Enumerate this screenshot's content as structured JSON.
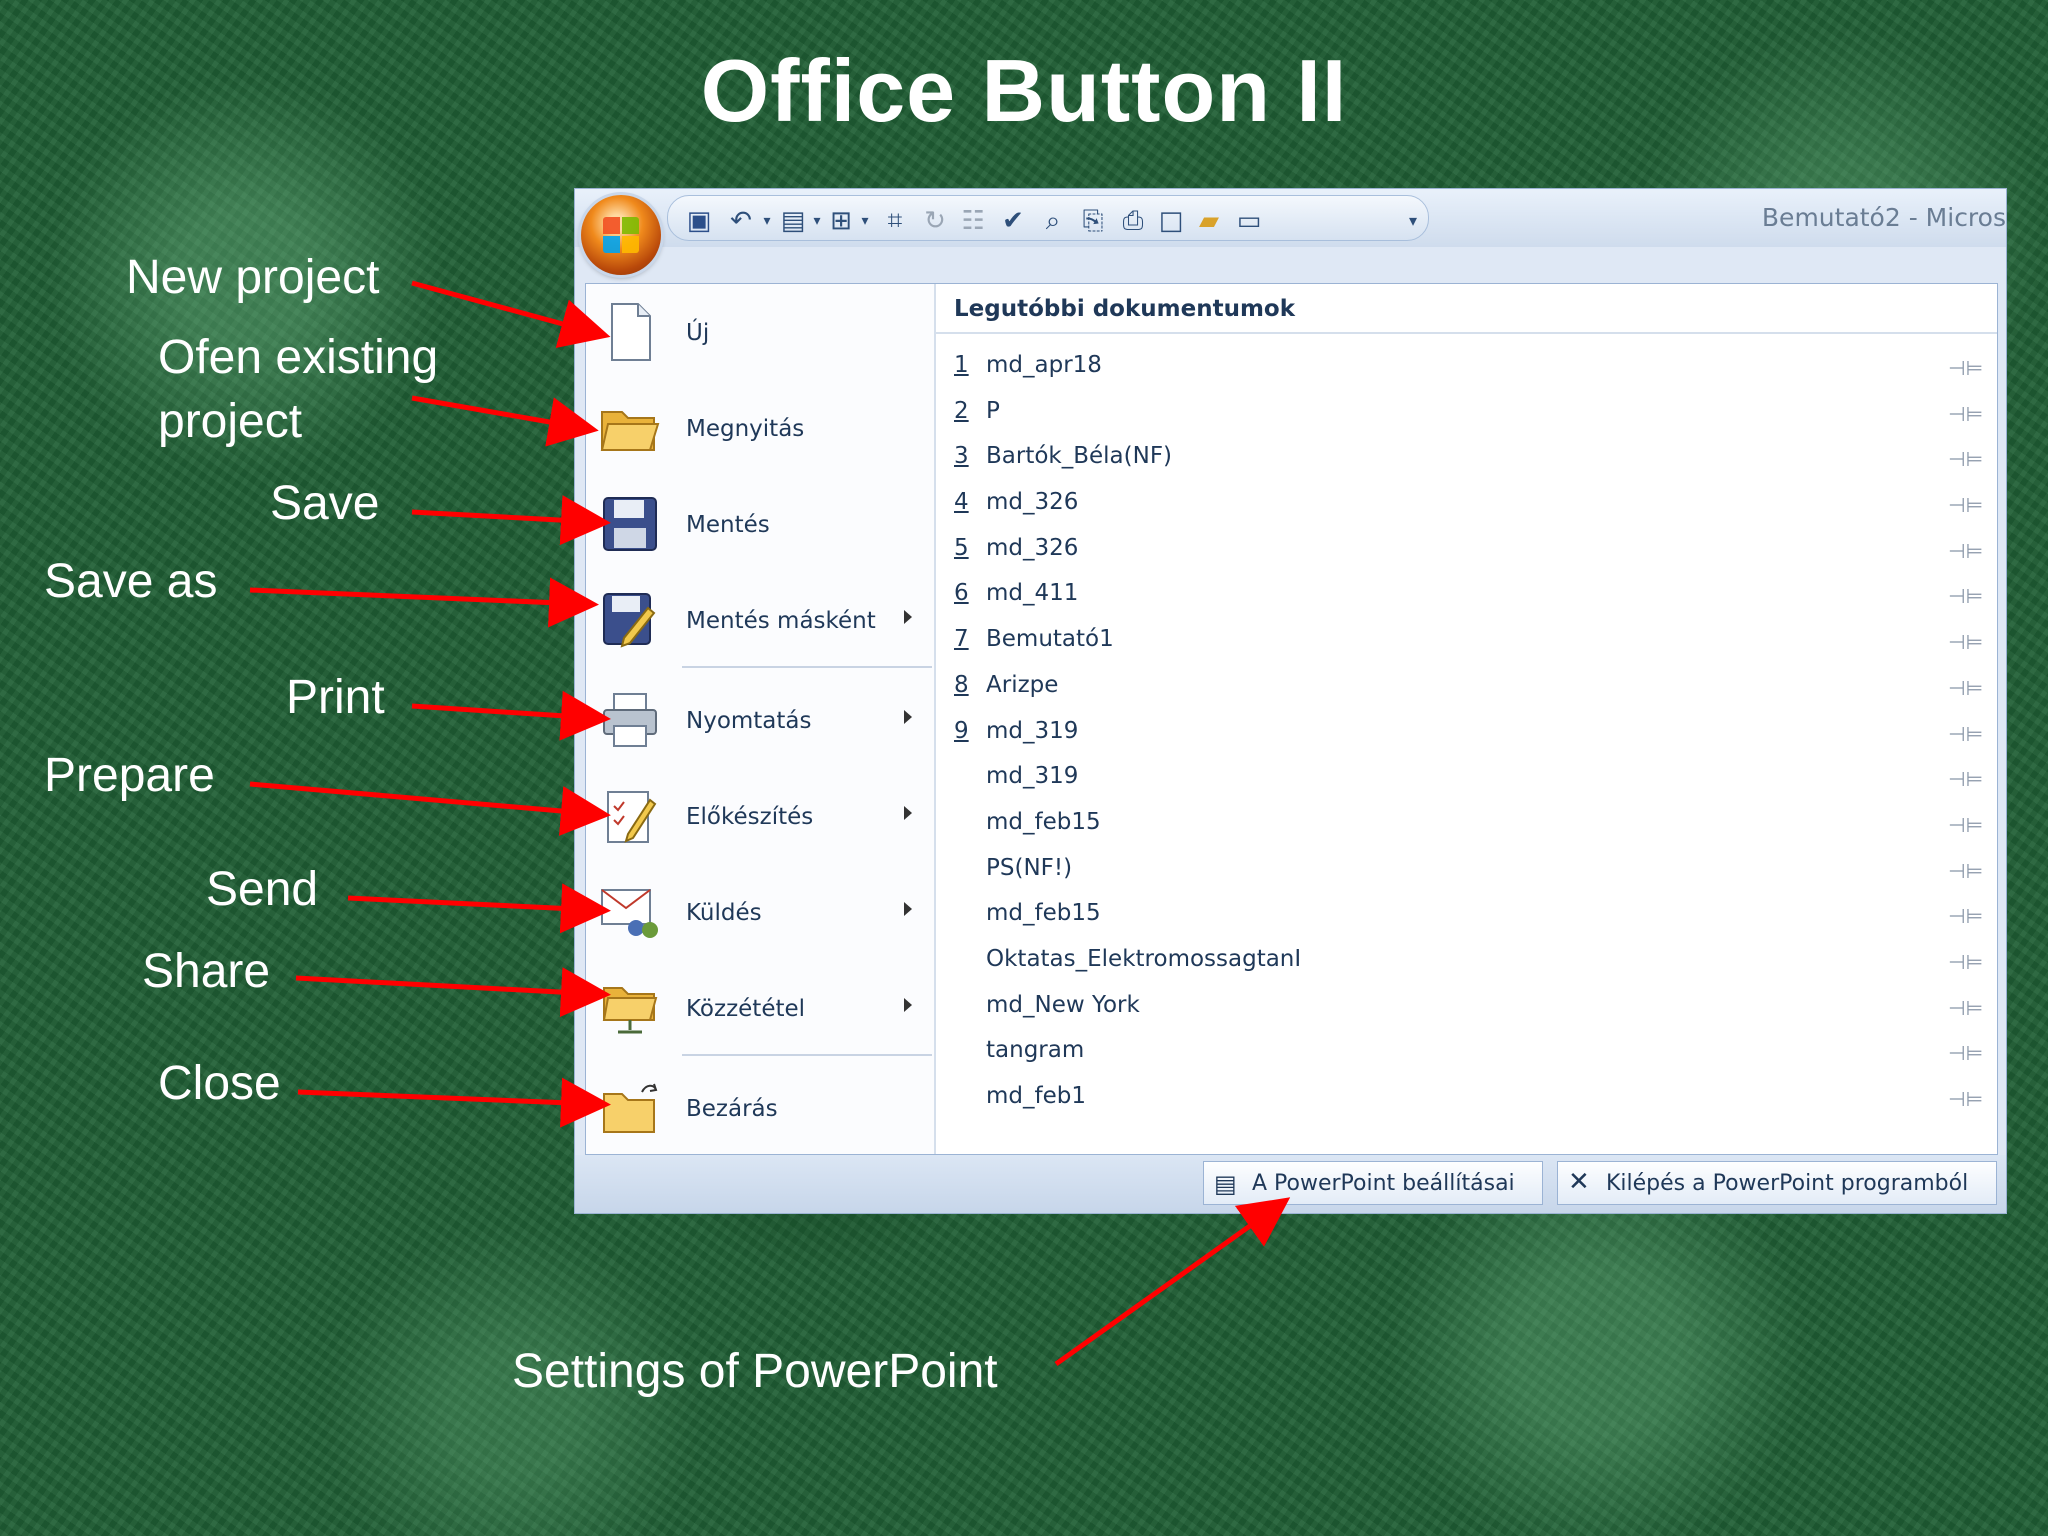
{
  "slide": {
    "title": "Office Button II",
    "labels": {
      "new_project": "New project",
      "open_line1": "Ofen existing",
      "open_line2": "project",
      "save": "Save",
      "save_as": "Save as",
      "print": "Print",
      "prepare": "Prepare",
      "send": "Send",
      "share": "Share",
      "close": "Close",
      "settings": "Settings of PowerPoint"
    },
    "arrow_color": "#ff0000"
  },
  "window": {
    "title": "Bemutató2 - Micros",
    "qat_icons": [
      "save-icon",
      "undo-icon",
      "dropdown-icon",
      "layout-icon",
      "dropdown-icon",
      "new-slide-icon",
      "dropdown-icon",
      "select-icon",
      "redo-icon",
      "paste-icon",
      "spelling-icon",
      "print-preview-icon",
      "attach-icon",
      "print-icon",
      "new-icon",
      "open-icon",
      "slideshow-icon",
      "customize-icon"
    ]
  },
  "menu": {
    "items": [
      {
        "label": "Új",
        "icon": "new-document-icon",
        "submenu": false
      },
      {
        "label": "Megnyitás",
        "icon": "open-folder-icon",
        "submenu": false
      },
      {
        "label": "Mentés",
        "icon": "floppy-disk-icon",
        "submenu": false
      },
      {
        "label": "Mentés másként",
        "icon": "save-as-icon",
        "submenu": true
      },
      {
        "label": "Nyomtatás",
        "icon": "printer-icon",
        "submenu": true
      },
      {
        "label": "Előkészítés",
        "icon": "prepare-icon",
        "submenu": true
      },
      {
        "label": "Küldés",
        "icon": "send-icon",
        "submenu": true
      },
      {
        "label": "Közzététel",
        "icon": "publish-icon",
        "submenu": true
      },
      {
        "label": "Bezárás",
        "icon": "close-folder-icon",
        "submenu": false
      }
    ]
  },
  "recent": {
    "heading": "Legutóbbi dokumentumok",
    "documents": [
      {
        "num": "1",
        "name": "md_apr18"
      },
      {
        "num": "2",
        "name": "P"
      },
      {
        "num": "3",
        "name": "Bartók_Béla(NF)"
      },
      {
        "num": "4",
        "name": "md_326"
      },
      {
        "num": "5",
        "name": "md_326"
      },
      {
        "num": "6",
        "name": "md_411"
      },
      {
        "num": "7",
        "name": "Bemutató1"
      },
      {
        "num": "8",
        "name": "Arizpe"
      },
      {
        "num": "9",
        "name": "md_319"
      },
      {
        "num": "",
        "name": "md_319"
      },
      {
        "num": "",
        "name": "md_feb15"
      },
      {
        "num": "",
        "name": "PS(NF!)"
      },
      {
        "num": "",
        "name": "md_feb15"
      },
      {
        "num": "",
        "name": "Oktatas_ElektromossagtanI"
      },
      {
        "num": "",
        "name": "md_New York"
      },
      {
        "num": "",
        "name": "tangram"
      },
      {
        "num": "",
        "name": "md_feb1"
      }
    ]
  },
  "bottom": {
    "options_label": "A PowerPoint beállításai",
    "exit_label": "Kilépés a PowerPoint programból"
  }
}
